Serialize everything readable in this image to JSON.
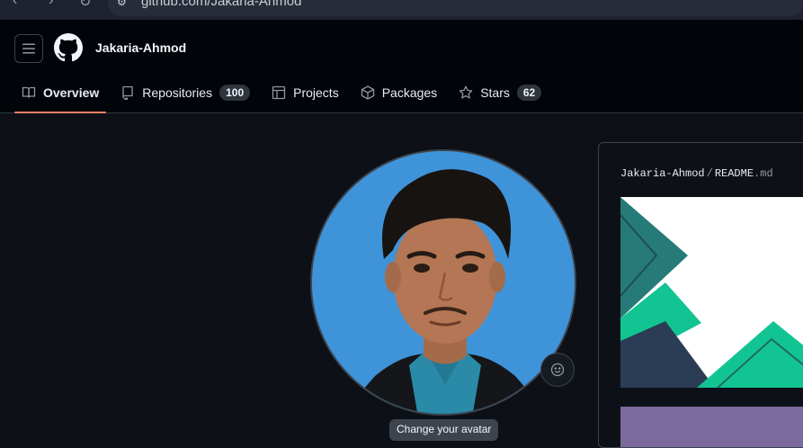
{
  "browser": {
    "url": "github.com/Jakaria-Ahmod"
  },
  "header": {
    "username": "Jakaria-Ahmod"
  },
  "tabs": [
    {
      "label": "Overview",
      "icon": "book-icon",
      "active": true
    },
    {
      "label": "Repositories",
      "icon": "repo-icon",
      "count": "100"
    },
    {
      "label": "Projects",
      "icon": "table-icon"
    },
    {
      "label": "Packages",
      "icon": "package-icon"
    },
    {
      "label": "Stars",
      "icon": "star-icon",
      "count": "62"
    }
  ],
  "profile": {
    "avatar_tooltip": "Change your avatar"
  },
  "readme": {
    "owner": "Jakaria-Ahmod",
    "separator": "/",
    "file": "README",
    "ext": ".md"
  },
  "colors": {
    "background": "#0d1117",
    "header": "#010409",
    "active_tab_underline": "#f78166",
    "avatar_bg": "#3f93d9"
  }
}
